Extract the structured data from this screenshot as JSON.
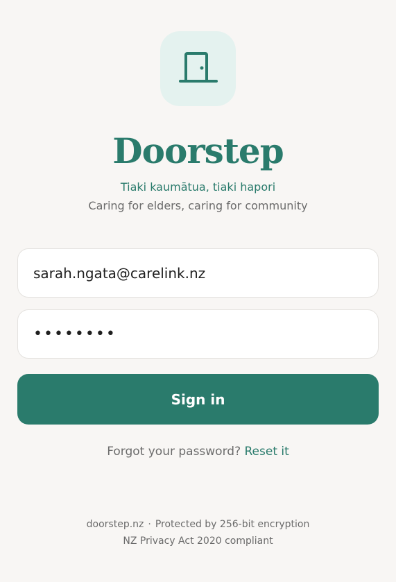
{
  "brand": {
    "name": "Doorstep",
    "tagline_maori": "Tiaki kaumātua, tiaki hapori",
    "tagline_english": "Caring for elders, caring for community",
    "logo_icon": "door-icon",
    "accent_color": "#2a7b6c",
    "logo_tile_color": "#e4f2ef"
  },
  "form": {
    "email_value": "sarah.ngata@carelink.nz",
    "password_value": "••••••••",
    "signin_label": "Sign in"
  },
  "forgot": {
    "prompt": "Forgot your password?",
    "link_label": "Reset it"
  },
  "footer": {
    "site": "doorstep.nz",
    "separator": "·",
    "security": "Protected by 256-bit encryption",
    "compliance": "NZ Privacy Act 2020 compliant"
  }
}
